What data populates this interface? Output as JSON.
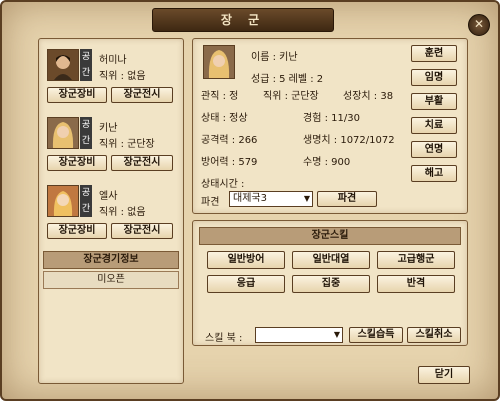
{
  "window": {
    "title": "장 군",
    "close_icon": "x"
  },
  "generals": [
    {
      "name": "허미나",
      "badge": "공간",
      "rank_label": "직위 :",
      "rank": "없음",
      "equip": "장군장비",
      "tactic": "장군전시"
    },
    {
      "name": "키난",
      "badge": "공간",
      "rank_label": "직위 :",
      "rank": "군단장",
      "equip": "장군장비",
      "tactic": "장군전시"
    },
    {
      "name": "엘사",
      "badge": "공간",
      "rank_label": "직위 :",
      "rank": "없음",
      "equip": "장군장비",
      "tactic": "장군전시"
    }
  ],
  "employ_info": {
    "title": "장군경기정보",
    "value": "미오픈"
  },
  "detail": {
    "name_label": "이름 :",
    "name": "키난",
    "level_text": "성급 : 5 레벨 : 2",
    "rank_line1": "관직 : 정",
    "rank_line2": "직위 : 군단장",
    "growth": "성장치 : 38",
    "status": "상태 : 정상",
    "exp": "경험 : 11/30",
    "attack": "공격력 : 266",
    "hp": "생명치 : 1072/1072",
    "defense": "방어력 : 579",
    "life": "수명 : 900",
    "status_time": "상태시간 :",
    "dispatch_label": "파견",
    "dispatch_value": "대제국3",
    "dispatch_button": "파견"
  },
  "side_buttons": [
    "훈련",
    "임명",
    "부활",
    "치료",
    "연명",
    "해고"
  ],
  "skills": {
    "title": "장군스킬",
    "items": [
      "일반방어",
      "일반대열",
      "고급행군",
      "응급",
      "집중",
      "반격"
    ],
    "book_label": "스킬 북 :",
    "book_value": "",
    "learn_button": "스킬습득",
    "cancel_button": "스킬취소"
  },
  "close_button": "닫기",
  "colors": {
    "frame": "#5a3e22",
    "panel": "#f1e4c6",
    "title_bar": "#4a3018"
  }
}
